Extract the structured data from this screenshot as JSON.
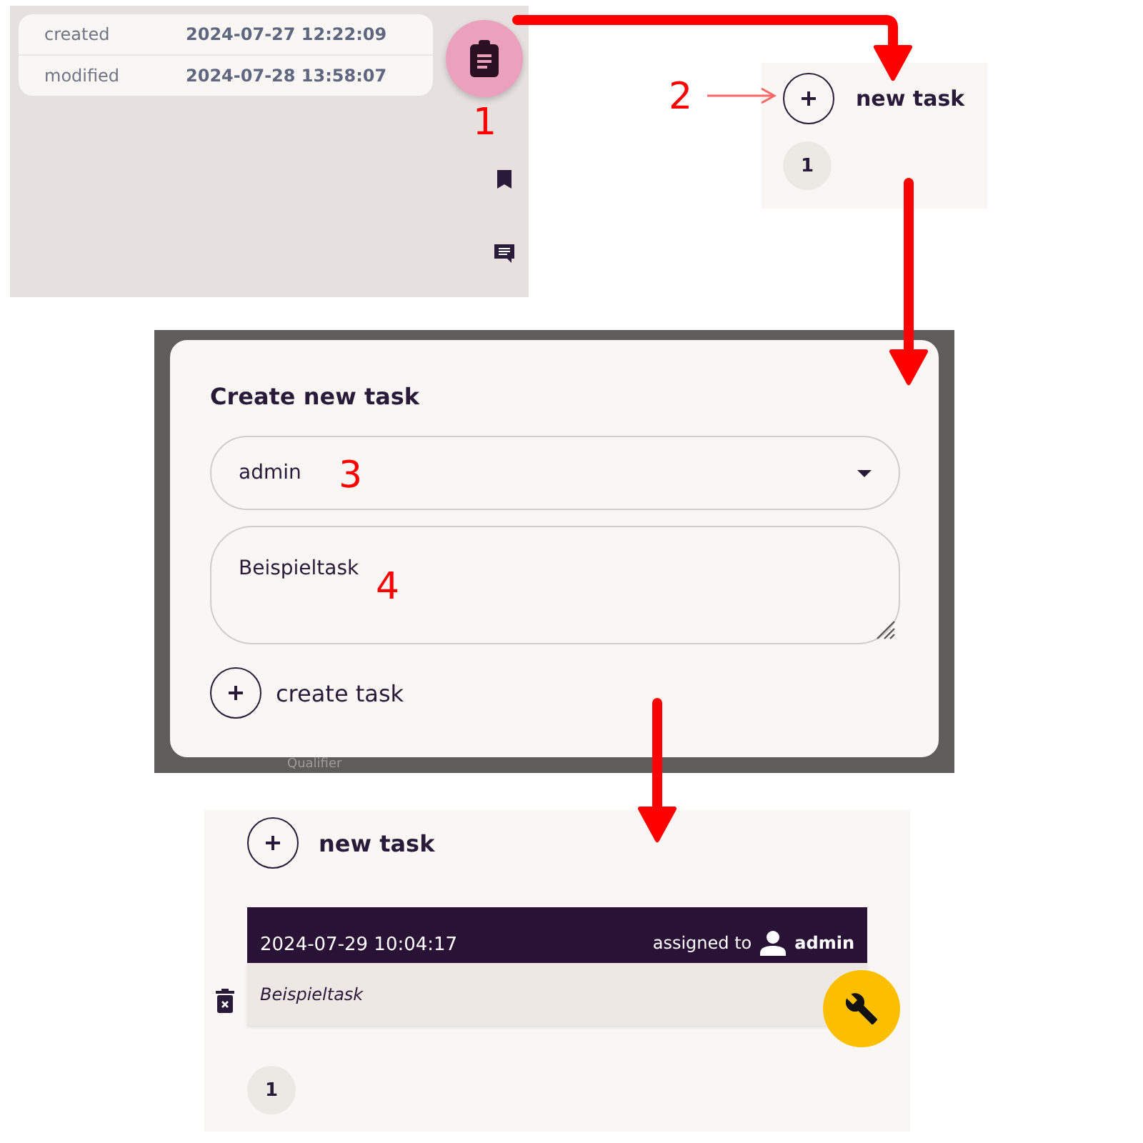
{
  "info_panel": {
    "rows": [
      {
        "label": "created",
        "value": "2024-07-27 12:22:09"
      },
      {
        "label": "modified",
        "value": "2024-07-28 13:58:07"
      }
    ]
  },
  "new_task_panel": {
    "button_label": "new task",
    "pages": [
      {
        "label": "1",
        "selected": true
      }
    ]
  },
  "dialog": {
    "title": "Create new task",
    "assignee": "admin",
    "description": "Beispieltask",
    "submit_label": "create task",
    "backdrop_text": "Qualifier"
  },
  "task_list": {
    "button_label": "new task",
    "tasks": [
      {
        "timestamp": "2024-07-29 10:04:17",
        "assigned_label": "assigned to",
        "assignee": "admin",
        "text": "Beispieltask"
      }
    ],
    "pages": [
      {
        "label": "1",
        "selected": true
      }
    ]
  },
  "annotations": [
    "1",
    "2",
    "3",
    "4"
  ]
}
